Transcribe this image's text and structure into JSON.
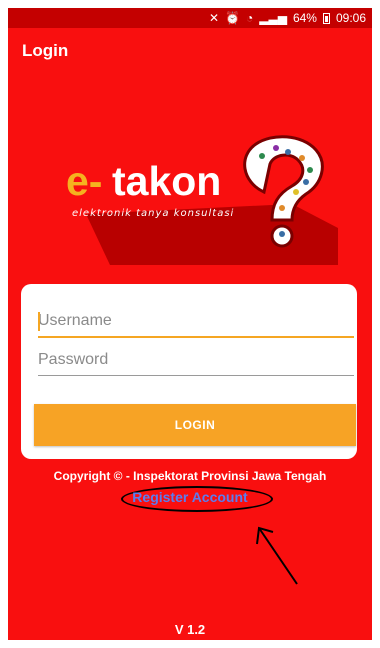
{
  "status_bar": {
    "battery": "64%",
    "time": "09:06"
  },
  "header": {
    "title": "Login"
  },
  "logo": {
    "brand_e": "e-",
    "brand_name": "takon",
    "tagline": "elektronik tanya konsultasi"
  },
  "form": {
    "username_placeholder": "Username",
    "username_value": "",
    "password_placeholder": "Password",
    "password_value": "",
    "login_label": "LOGIN"
  },
  "footer": {
    "copyright": "Copyright © - Inspektorat Provinsi Jawa Tengah",
    "register_label": "Register Account",
    "version": "V 1.2"
  },
  "colors": {
    "background": "#f90f0f",
    "status_bar": "#c40000",
    "button": "#f7a325",
    "link": "#5b7df0"
  }
}
